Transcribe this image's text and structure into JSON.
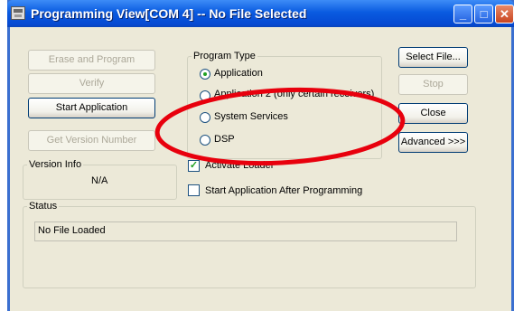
{
  "window": {
    "title": "Programming View[COM 4] -- No File Selected",
    "minimize": "_",
    "maximize": "□",
    "close": "✕"
  },
  "left_buttons": {
    "erase_program": "Erase and Program",
    "verify": "Verify",
    "start_application": "Start Application",
    "get_version": "Get Version Number"
  },
  "program_type": {
    "legend": "Program Type",
    "options": [
      {
        "label": "Application",
        "selected": true
      },
      {
        "label": "Application 2 (only certain receivers)",
        "selected": false
      },
      {
        "label": "System Services",
        "selected": false
      },
      {
        "label": "DSP",
        "selected": false
      }
    ]
  },
  "right_buttons": {
    "select_file": "Select File...",
    "stop": "Stop",
    "close": "Close",
    "advanced": "Advanced >>>"
  },
  "version_info": {
    "legend": "Version Info",
    "value": "N/A"
  },
  "options": {
    "activate_loader": "Activate Loader",
    "activate_loader_checked": true,
    "start_after": "Start Application After Programming",
    "start_after_checked": false
  },
  "status": {
    "legend": "Status",
    "text": "No File Loaded"
  },
  "colors": {
    "highlight_ellipse": "#e8000d",
    "titlebar": "#0a5be0"
  }
}
